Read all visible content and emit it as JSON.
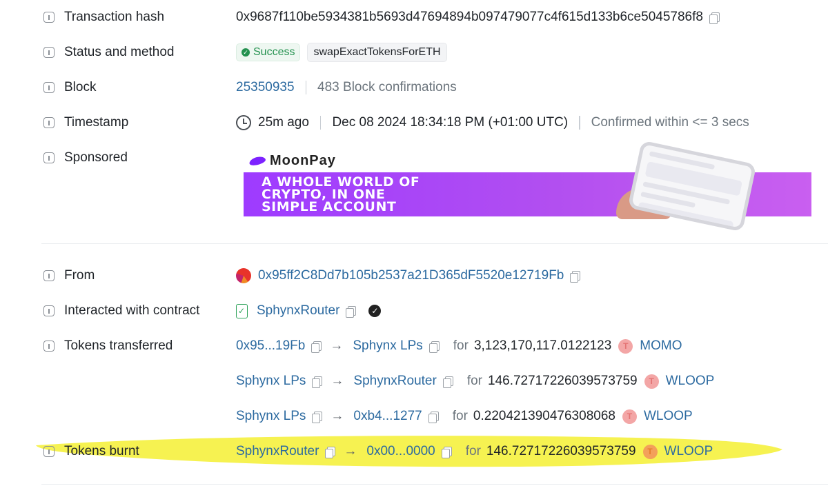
{
  "rows": {
    "tx_hash": {
      "label": "Transaction hash",
      "value": "0x9687f110be5934381b5693d47694894b097479077c4f615d133b6ce5045786f8"
    },
    "status": {
      "label": "Status and method",
      "status": "Success",
      "method": "swapExactTokensForETH"
    },
    "block": {
      "label": "Block",
      "number": "25350935",
      "confirmations": "483 Block confirmations"
    },
    "timestamp": {
      "label": "Timestamp",
      "ago": "25m ago",
      "datetime": "Dec 08 2024 18:34:18 PM (+01:00 UTC)",
      "confirmed": "Confirmed within <= 3 secs"
    },
    "sponsored": {
      "label": "Sponsored",
      "brand": "MoonPay",
      "tagline_1": "A WHOLE WORLD OF",
      "tagline_2": "CRYPTO, IN ONE",
      "tagline_3": "SIMPLE ACCOUNT"
    },
    "from": {
      "label": "From",
      "address": "0x95ff2C8Dd7b105b2537a21D365dF5520e12719Fb"
    },
    "contract": {
      "label": "Interacted with contract",
      "name": "SphynxRouter"
    },
    "tokens_transferred": {
      "label": "Tokens transferred",
      "transfers": [
        {
          "from": "0x95...19Fb",
          "to": "Sphynx LPs",
          "for": "for",
          "amount": "3,123,170,117.0122123",
          "token_icon": "T",
          "token": "MOMO"
        },
        {
          "from": "Sphynx LPs",
          "to": "SphynxRouter",
          "for": "for",
          "amount": "146.72717226039573759",
          "token_icon": "T",
          "token": "WLOOP"
        },
        {
          "from": "Sphynx LPs",
          "to": "0xb4...1277",
          "for": "for",
          "amount": "0.220421390476308068",
          "token_icon": "T",
          "token": "WLOOP"
        }
      ]
    },
    "tokens_burnt": {
      "label": "Tokens burnt",
      "from": "SphynxRouter",
      "to": "0x00...0000",
      "for": "for",
      "amount": "146.72717226039573759",
      "token_icon": "T",
      "token": "WLOOP"
    }
  },
  "arrow_glyph": "→",
  "colors": {
    "link": "#2c6aa0",
    "success": "#24914f",
    "highlight": "#f5f032"
  }
}
